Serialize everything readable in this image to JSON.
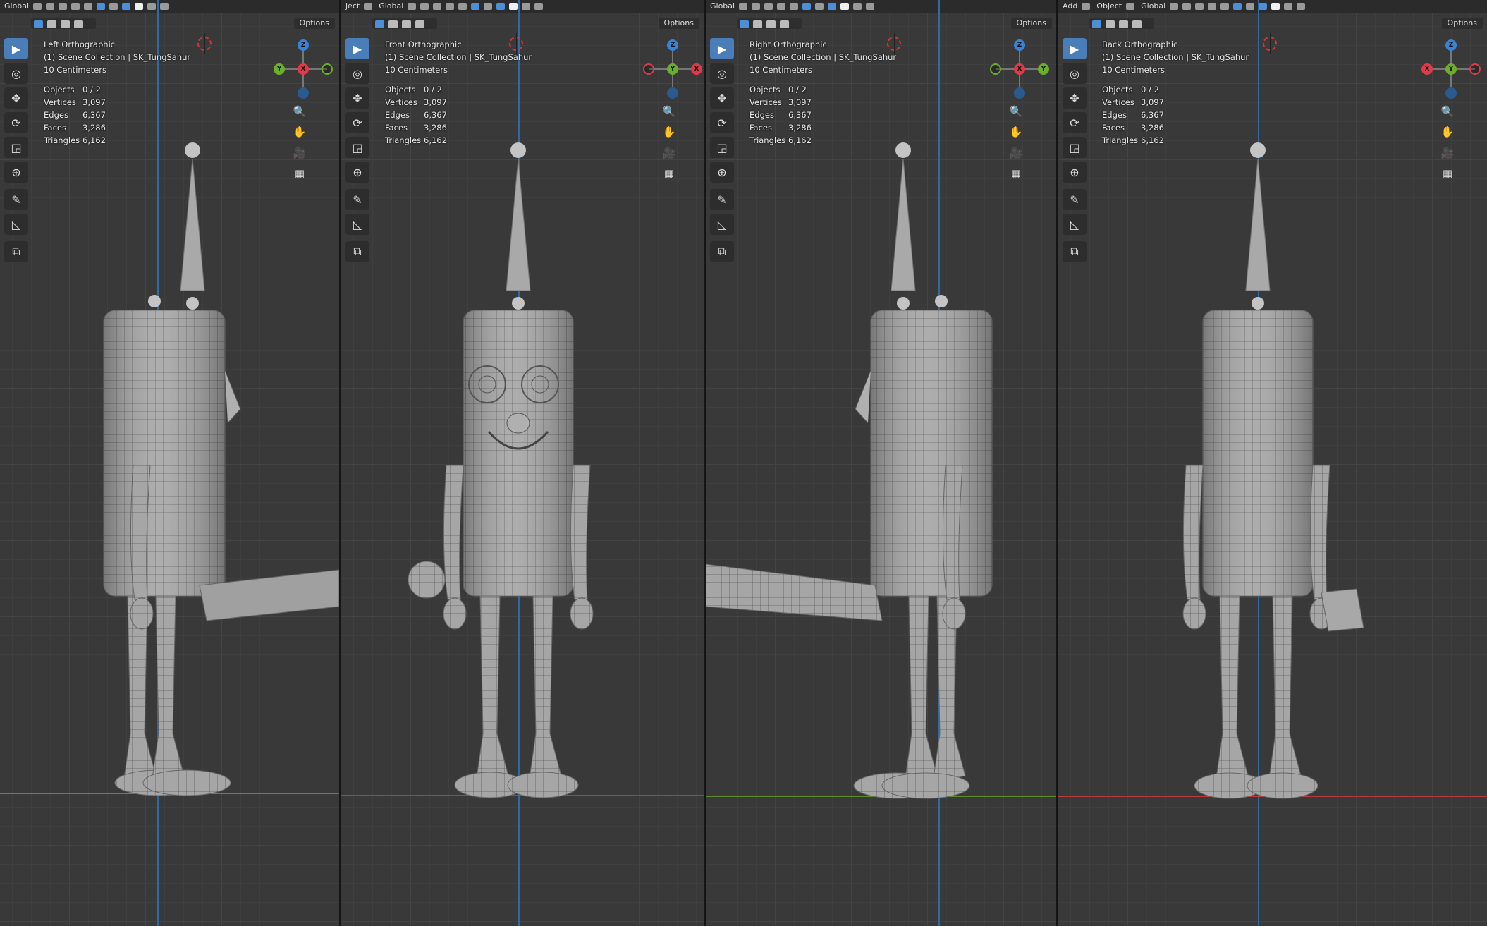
{
  "viewports": [
    {
      "name": "left",
      "title": "Left Orthographic",
      "collection": "(1) Scene Collection | SK_TungSahur",
      "scale": "10 Centimeters",
      "header_items": [
        "Global"
      ],
      "options": "Options",
      "gizmo": {
        "center": "X",
        "center_color": "#e03a4a",
        "left": "Y",
        "left_color": "#6cae2c",
        "right": "",
        "right_color": "#6cae2c"
      }
    },
    {
      "name": "front",
      "title": "Front Orthographic",
      "collection": "(1) Scene Collection | SK_TungSahur",
      "scale": "10 Centimeters",
      "header_items": [
        "ject",
        "Global"
      ],
      "options": "Options",
      "gizmo": {
        "center": "Y",
        "center_color": "#6cae2c",
        "left": "",
        "left_color": "#e03a4a",
        "right": "X",
        "right_color": "#e03a4a"
      }
    },
    {
      "name": "right",
      "title": "Right Orthographic",
      "collection": "(1) Scene Collection | SK_TungSahur",
      "scale": "10 Centimeters",
      "header_items": [
        "Global"
      ],
      "options": "Options",
      "gizmo": {
        "center": "X",
        "center_color": "#e03a4a",
        "left": "",
        "left_color": "#6cae2c",
        "right": "Y",
        "right_color": "#6cae2c"
      }
    },
    {
      "name": "back",
      "title": "Back Orthographic",
      "collection": "(1) Scene Collection | SK_TungSahur",
      "scale": "10 Centimeters",
      "header_items": [
        "Add",
        "Object",
        "Global"
      ],
      "options": "Options",
      "gizmo": {
        "center": "Y",
        "center_color": "#6cae2c",
        "left": "X",
        "left_color": "#e03a4a",
        "right": "",
        "right_color": "#e03a4a"
      }
    }
  ],
  "stats": {
    "objects_label": "Objects",
    "objects": "0 / 2",
    "vertices_label": "Vertices",
    "vertices": "3,097",
    "edges_label": "Edges",
    "edges": "6,367",
    "faces_label": "Faces",
    "faces": "3,286",
    "triangles_label": "Triangles",
    "triangles": "6,162"
  },
  "gizmo_z": "Z",
  "colors": {
    "axis_x": "#b83a3a",
    "axis_y": "#5d8a2c",
    "axis_z": "#2e6aa8",
    "active_tool": "#4a7eb8",
    "mesh": "#9a9a9a"
  }
}
